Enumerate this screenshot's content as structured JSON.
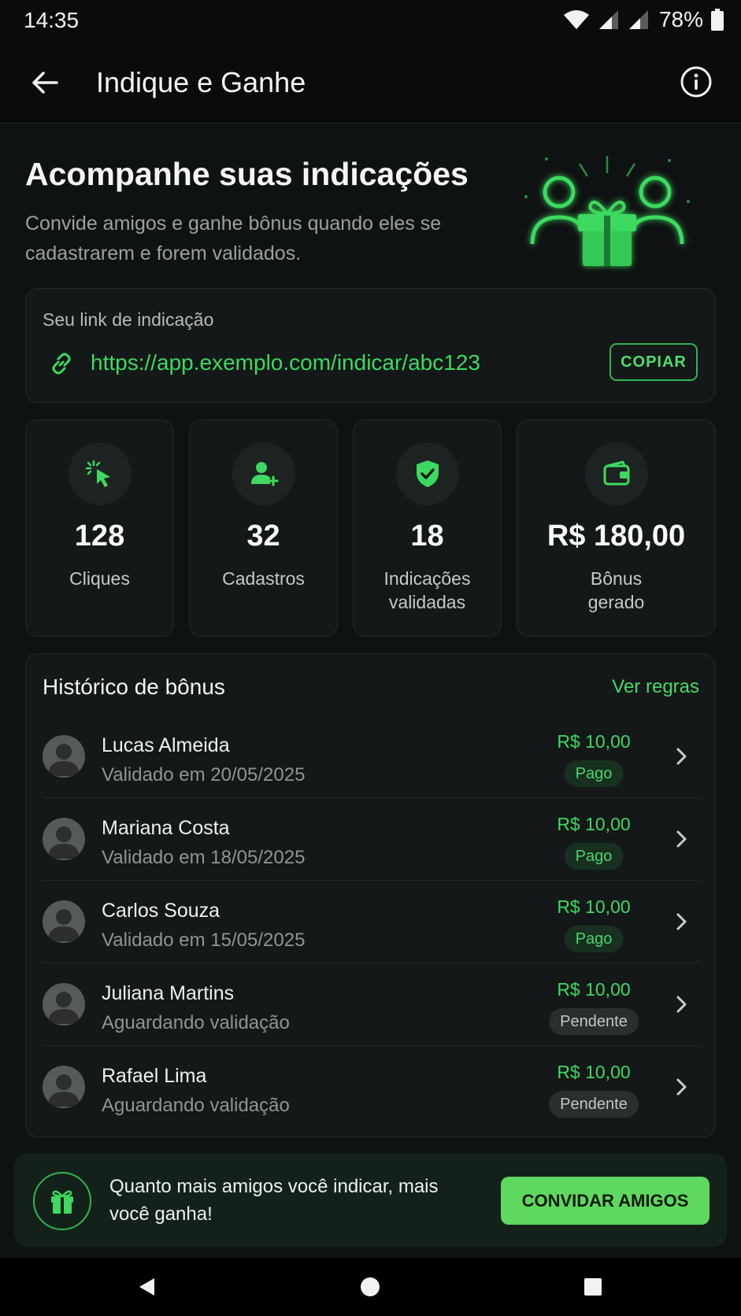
{
  "status_bar": {
    "time": "14:35",
    "battery": "78%"
  },
  "app_bar": {
    "title": "Indique e Ganhe"
  },
  "hero": {
    "title": "Acompanhe suas indicações",
    "subtitle": "Convide amigos e ganhe bônus quando eles se cadastrarem e forem validados."
  },
  "referral": {
    "label": "Seu link de indicação",
    "url": "https://app.exemplo.com/indicar/abc123",
    "copy_label": "COPIAR"
  },
  "stats": [
    {
      "icon": "cursor-click-icon",
      "value": "128",
      "label": "Cliques"
    },
    {
      "icon": "user-add-icon",
      "value": "32",
      "label": "Cadastros"
    },
    {
      "icon": "shield-check-icon",
      "value": "18",
      "label": "Indicações validadas"
    },
    {
      "icon": "wallet-icon",
      "value": "R$ 180,00",
      "label": "Bônus gerado"
    }
  ],
  "history": {
    "title": "Histórico de bônus",
    "rules_link": "Ver regras",
    "items": [
      {
        "name": "Lucas Almeida",
        "subtitle": "Validado em 20/05/2025",
        "amount": "R$ 10,00",
        "status": "Pago",
        "status_type": "paid"
      },
      {
        "name": "Mariana Costa",
        "subtitle": "Validado em 18/05/2025",
        "amount": "R$ 10,00",
        "status": "Pago",
        "status_type": "paid"
      },
      {
        "name": "Carlos Souza",
        "subtitle": "Validado em 15/05/2025",
        "amount": "R$ 10,00",
        "status": "Pago",
        "status_type": "paid"
      },
      {
        "name": "Juliana Martins",
        "subtitle": "Aguardando validação",
        "amount": "R$ 10,00",
        "status": "Pendente",
        "status_type": "pending"
      },
      {
        "name": "Rafael Lima",
        "subtitle": "Aguardando validação",
        "amount": "R$ 10,00",
        "status": "Pendente",
        "status_type": "pending"
      }
    ]
  },
  "banner": {
    "text": "Quanto mais amigos você indicar, mais você ganha!",
    "button_label": "CONVIDAR AMIGOS"
  },
  "colors": {
    "accent": "#3dd960",
    "background": "#0f1212",
    "card": "#141818"
  }
}
